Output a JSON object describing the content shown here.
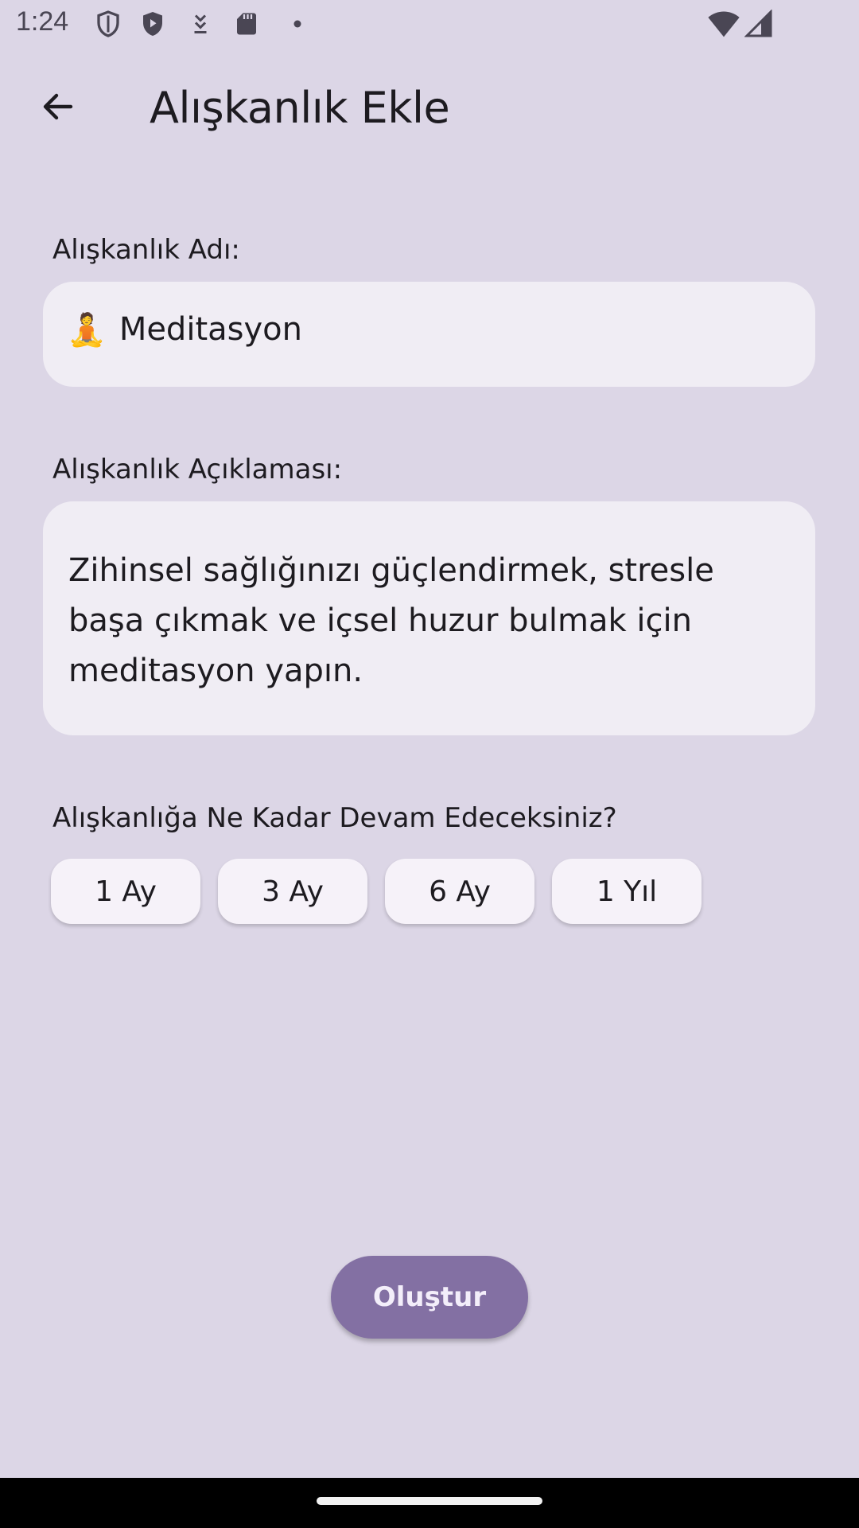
{
  "status_bar": {
    "time": "1:24",
    "icons": [
      "shield-outline-icon",
      "shield-play-icon",
      "download-icon",
      "sd-card-icon",
      "dot-icon",
      "wifi-icon",
      "cell-signal-icon"
    ]
  },
  "app_bar": {
    "title": "Alışkanlık Ekle",
    "back_icon": "arrow-back-icon"
  },
  "form": {
    "name_label": "Alışkanlık Adı:",
    "name_emoji": "🧘",
    "name_value": "Meditasyon",
    "description_label": "Alışkanlık Açıklaması:",
    "description_value": "Zihinsel sağlığınızı güçlendirmek, stresle başa çıkmak ve içsel huzur bulmak için meditasyon yapın.",
    "duration_question": "Alışkanlığa Ne Kadar Devam Edeceksiniz?",
    "duration_options": [
      "1 Ay",
      "3 Ay",
      "6 Ay",
      "1 Yıl"
    ]
  },
  "actions": {
    "create_label": "Oluştur"
  },
  "colors": {
    "background": "#dcd6e6",
    "field": "#f0edf4",
    "chip": "#f6f2f9",
    "primary_button": "#8370a3"
  }
}
